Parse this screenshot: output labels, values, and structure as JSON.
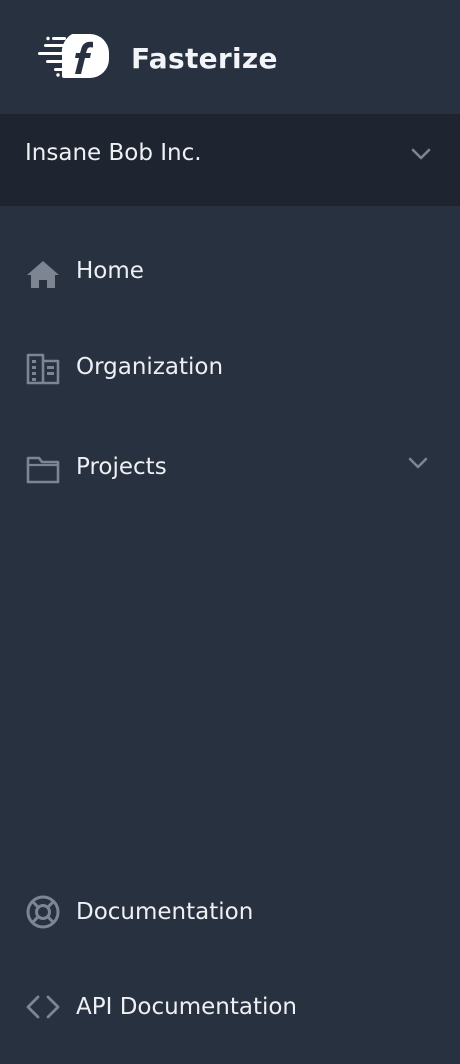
{
  "brand": {
    "name": "Fasterize",
    "logo_icon": "fasterize-logo-icon"
  },
  "org_switcher": {
    "name": "Insane Bob Inc.",
    "icon": "chevron-down-icon"
  },
  "nav": {
    "items": [
      {
        "label": "Home",
        "icon": "home-icon"
      },
      {
        "label": "Organization",
        "icon": "building-icon"
      },
      {
        "label": "Projects",
        "icon": "folder-icon",
        "has_submenu": true
      }
    ]
  },
  "footer_nav": {
    "items": [
      {
        "label": "Documentation",
        "icon": "lifebuoy-icon"
      },
      {
        "label": "API Documentation",
        "icon": "code-icon"
      }
    ]
  },
  "colors": {
    "sidebar_bg": "#283140",
    "org_switcher_bg": "#1e2530",
    "icon": "#7d8593",
    "text": "#eef0f3"
  }
}
